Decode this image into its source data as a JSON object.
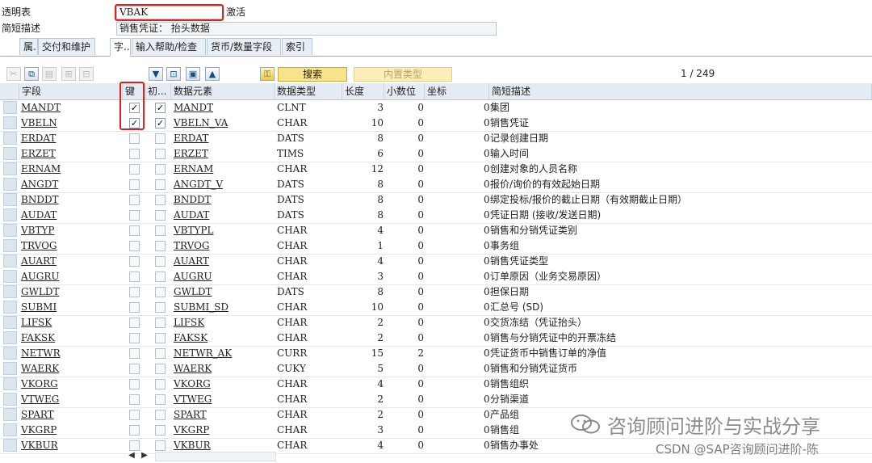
{
  "header": {
    "table_label": "透明表",
    "table_value": "VBAK",
    "status": "激活",
    "desc_label": "简短描述",
    "desc_value": "销售凭证： 抬头数据"
  },
  "tabs": [
    {
      "label": "属."
    },
    {
      "label": "交付和维护"
    },
    {
      "label": "字.."
    },
    {
      "label": "输入帮助/检查"
    },
    {
      "label": "货币/数量字段"
    },
    {
      "label": "索引"
    }
  ],
  "toolbar": {
    "icons": [
      "cut-icon",
      "copy-icon",
      "paste-icon",
      "insert-row-icon",
      "delete-row-icon",
      "filter-icon",
      "ref-icon",
      "new-icon",
      "up-icon",
      "key-icon"
    ],
    "search_label": "搜索",
    "builtin_label": "内置类型",
    "pager": "1  /  249"
  },
  "columns": {
    "field": "字段",
    "key": "键",
    "init": "初...",
    "data_element": "数据元素",
    "data_type": "数据类型",
    "length": "长度",
    "decimals": "小数位",
    "coord": "坐标",
    "short_desc": "简短描述"
  },
  "rows": [
    {
      "field": "MANDT",
      "key": true,
      "init": true,
      "de": "MANDT",
      "type": "CLNT",
      "len": "3",
      "dec": "0",
      "coord": "0",
      "desc": "集团"
    },
    {
      "field": "VBELN",
      "key": true,
      "init": true,
      "de": "VBELN_VA",
      "type": "CHAR",
      "len": "10",
      "dec": "0",
      "coord": "0",
      "desc": "销售凭证"
    },
    {
      "field": "ERDAT",
      "key": false,
      "init": false,
      "de": "ERDAT",
      "type": "DATS",
      "len": "8",
      "dec": "0",
      "coord": "0",
      "desc": "记录创建日期"
    },
    {
      "field": "ERZET",
      "key": false,
      "init": false,
      "de": "ERZET",
      "type": "TIMS",
      "len": "6",
      "dec": "0",
      "coord": "0",
      "desc": "输入时间"
    },
    {
      "field": "ERNAM",
      "key": false,
      "init": false,
      "de": "ERNAM",
      "type": "CHAR",
      "len": "12",
      "dec": "0",
      "coord": "0",
      "desc": "创建对象的人员名称"
    },
    {
      "field": "ANGDT",
      "key": false,
      "init": false,
      "de": "ANGDT_V",
      "type": "DATS",
      "len": "8",
      "dec": "0",
      "coord": "0",
      "desc": "报价/询价的有效起始日期"
    },
    {
      "field": "BNDDT",
      "key": false,
      "init": false,
      "de": "BNDDT",
      "type": "DATS",
      "len": "8",
      "dec": "0",
      "coord": "0",
      "desc": "绑定投标/报价的截止日期（有效期截止日期）"
    },
    {
      "field": "AUDAT",
      "key": false,
      "init": false,
      "de": "AUDAT",
      "type": "DATS",
      "len": "8",
      "dec": "0",
      "coord": "0",
      "desc": "凭证日期 (接收/发送日期)"
    },
    {
      "field": "VBTYP",
      "key": false,
      "init": false,
      "de": "VBTYPL",
      "type": "CHAR",
      "len": "4",
      "dec": "0",
      "coord": "0",
      "desc": "销售和分销凭证类别"
    },
    {
      "field": "TRVOG",
      "key": false,
      "init": false,
      "de": "TRVOG",
      "type": "CHAR",
      "len": "1",
      "dec": "0",
      "coord": "0",
      "desc": "事务组"
    },
    {
      "field": "AUART",
      "key": false,
      "init": false,
      "de": "AUART",
      "type": "CHAR",
      "len": "4",
      "dec": "0",
      "coord": "0",
      "desc": "销售凭证类型"
    },
    {
      "field": "AUGRU",
      "key": false,
      "init": false,
      "de": "AUGRU",
      "type": "CHAR",
      "len": "3",
      "dec": "0",
      "coord": "0",
      "desc": "订单原因（业务交易原因）"
    },
    {
      "field": "GWLDT",
      "key": false,
      "init": false,
      "de": "GWLDT",
      "type": "DATS",
      "len": "8",
      "dec": "0",
      "coord": "0",
      "desc": "担保日期"
    },
    {
      "field": "SUBMI",
      "key": false,
      "init": false,
      "de": "SUBMI_SD",
      "type": "CHAR",
      "len": "10",
      "dec": "0",
      "coord": "0",
      "desc": "汇总号 (SD)"
    },
    {
      "field": "LIFSK",
      "key": false,
      "init": false,
      "de": "LIFSK",
      "type": "CHAR",
      "len": "2",
      "dec": "0",
      "coord": "0",
      "desc": "交货冻结（凭证抬头）"
    },
    {
      "field": "FAKSK",
      "key": false,
      "init": false,
      "de": "FAKSK",
      "type": "CHAR",
      "len": "2",
      "dec": "0",
      "coord": "0",
      "desc": "销售与分销凭证中的开票冻结"
    },
    {
      "field": "NETWR",
      "key": false,
      "init": false,
      "de": "NETWR_AK",
      "type": "CURR",
      "len": "15",
      "dec": "2",
      "coord": "0",
      "desc": "凭证货币中销售订单的净值"
    },
    {
      "field": "WAERK",
      "key": false,
      "init": false,
      "de": "WAERK",
      "type": "CUKY",
      "len": "5",
      "dec": "0",
      "coord": "0",
      "desc": "销售和分销凭证货币"
    },
    {
      "field": "VKORG",
      "key": false,
      "init": false,
      "de": "VKORG",
      "type": "CHAR",
      "len": "4",
      "dec": "0",
      "coord": "0",
      "desc": "销售组织"
    },
    {
      "field": "VTWEG",
      "key": false,
      "init": false,
      "de": "VTWEG",
      "type": "CHAR",
      "len": "2",
      "dec": "0",
      "coord": "0",
      "desc": "分销渠道"
    },
    {
      "field": "SPART",
      "key": false,
      "init": false,
      "de": "SPART",
      "type": "CHAR",
      "len": "2",
      "dec": "0",
      "coord": "0",
      "desc": "产品组"
    },
    {
      "field": "VKGRP",
      "key": false,
      "init": false,
      "de": "VKGRP",
      "type": "CHAR",
      "len": "3",
      "dec": "0",
      "coord": "0",
      "desc": "销售组"
    },
    {
      "field": "VKBUR",
      "key": false,
      "init": false,
      "de": "VKBUR",
      "type": "CHAR",
      "len": "4",
      "dec": "0",
      "coord": "0",
      "desc": "销售办事处"
    }
  ],
  "watermark": {
    "line1": "咨询顾问进阶与实战分享",
    "line2": "CSDN @SAP咨询顾问进阶-陈"
  },
  "colors": {
    "highlight": "#e02020",
    "search_button": "#f7e38a",
    "tab_bg": "#e8eef5"
  }
}
